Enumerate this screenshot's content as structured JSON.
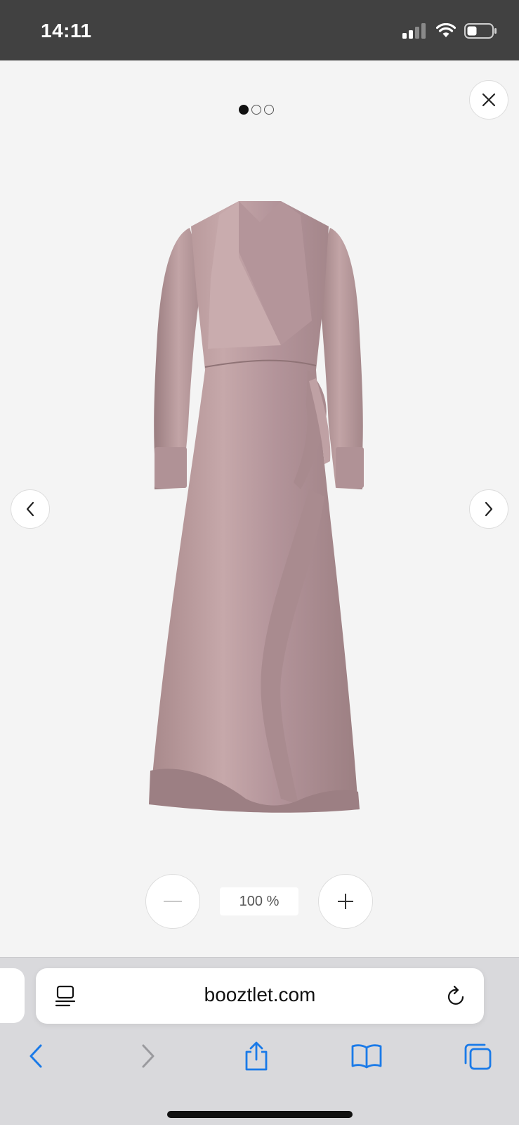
{
  "status_bar": {
    "time": "14:11"
  },
  "viewer": {
    "pagination": {
      "total": 3,
      "active_index": 0
    },
    "zoom": {
      "level_label": "100 %"
    },
    "icons": {
      "close": "close-icon",
      "prev": "chevron-left-icon",
      "next": "chevron-right-icon",
      "zoom_out": "minus-icon",
      "zoom_in": "plus-icon"
    }
  },
  "browser": {
    "url": "booztlet.com"
  },
  "colors": {
    "status_bar_bg": "#414141",
    "viewer_bg": "#f4f4f4",
    "chrome_bg": "#d9d9dc",
    "ios_blue": "#1a7ae8",
    "dress": "#b89a9c"
  }
}
